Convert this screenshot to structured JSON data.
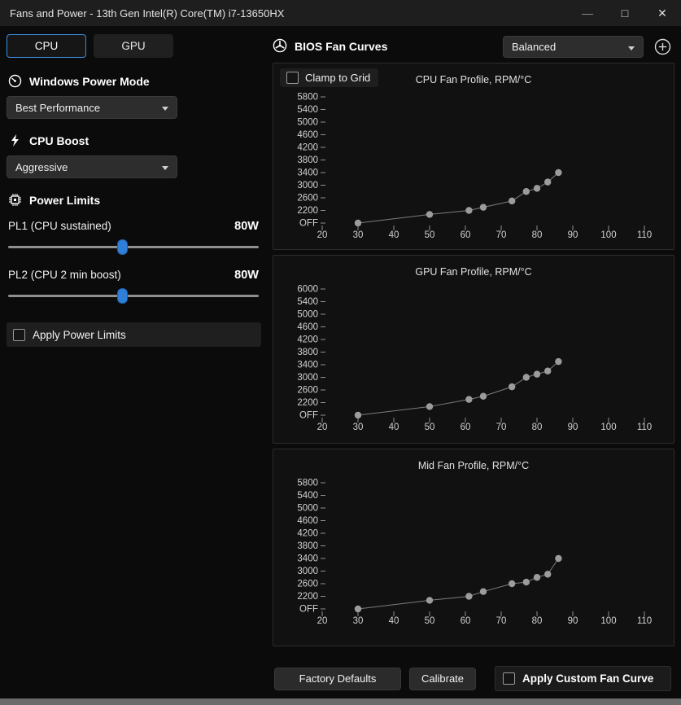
{
  "window": {
    "title": "Fans and Power - 13th Gen Intel(R) Core(TM) i7-13650HX",
    "controls": {
      "minimize": "—",
      "maximize": "□",
      "close": "✕"
    }
  },
  "tabs": {
    "cpu": "CPU",
    "gpu": "GPU"
  },
  "left": {
    "power_mode": {
      "label": "Windows Power Mode",
      "value": "Best Performance"
    },
    "cpu_boost": {
      "label": "CPU Boost",
      "value": "Aggressive"
    },
    "power_limits": {
      "label": "Power Limits",
      "pl1": {
        "label": "PL1 (CPU sustained)",
        "value": "80W",
        "percent": 45.5
      },
      "pl2": {
        "label": "PL2 (CPU 2 min boost)",
        "value": "80W",
        "percent": 45.5
      },
      "apply_label": "Apply Power Limits"
    }
  },
  "right": {
    "header": {
      "title": "BIOS Fan Curves",
      "preset": "Balanced"
    },
    "clamp_label": "Clamp to Grid",
    "footer": {
      "factory": "Factory Defaults",
      "calibrate": "Calibrate",
      "apply_custom": "Apply Custom Fan Curve"
    }
  },
  "colors": {
    "accent": "#3e8ee0",
    "chart_dot": "#9c9c9c",
    "chart_line": "#7d7d7d",
    "tick": "#8f8f8f"
  },
  "chart_data": [
    {
      "type": "scatter",
      "title": "CPU Fan Profile, RPM/°C",
      "x_ticks": [
        20,
        30,
        40,
        50,
        60,
        70,
        80,
        90,
        100,
        110
      ],
      "y_tick_labels": [
        "OFF",
        "2200",
        "2600",
        "3000",
        "3400",
        "3800",
        "4200",
        "4600",
        "5000",
        "5400",
        "5800"
      ],
      "y_tick_values": [
        0,
        2200,
        2600,
        3000,
        3400,
        3800,
        4200,
        4600,
        5000,
        5400,
        5800
      ],
      "points": [
        [
          30,
          0
        ],
        [
          50,
          1500
        ],
        [
          61,
          2200
        ],
        [
          65,
          2300
        ],
        [
          73,
          2500
        ],
        [
          77,
          2800
        ],
        [
          80,
          2900
        ],
        [
          83,
          3100
        ],
        [
          86,
          3400
        ]
      ]
    },
    {
      "type": "scatter",
      "title": "GPU Fan Profile, RPM/°C",
      "x_ticks": [
        20,
        30,
        40,
        50,
        60,
        70,
        80,
        90,
        100,
        110
      ],
      "y_tick_labels": [
        "OFF",
        "2200",
        "2600",
        "3000",
        "3400",
        "3800",
        "4200",
        "4600",
        "5000",
        "5400",
        "6000"
      ],
      "y_tick_values": [
        0,
        2200,
        2600,
        3000,
        3400,
        3800,
        4200,
        4600,
        5000,
        5400,
        6000
      ],
      "points": [
        [
          30,
          0
        ],
        [
          50,
          1500
        ],
        [
          61,
          2300
        ],
        [
          65,
          2400
        ],
        [
          73,
          2700
        ],
        [
          77,
          3000
        ],
        [
          80,
          3100
        ],
        [
          83,
          3200
        ],
        [
          86,
          3500
        ]
      ]
    },
    {
      "type": "scatter",
      "title": "Mid Fan Profile, RPM/°C",
      "x_ticks": [
        20,
        30,
        40,
        50,
        60,
        70,
        80,
        90,
        100,
        110
      ],
      "y_tick_labels": [
        "OFF",
        "2200",
        "2600",
        "3000",
        "3400",
        "3800",
        "4200",
        "4600",
        "5000",
        "5400",
        "5800"
      ],
      "y_tick_values": [
        0,
        2200,
        2600,
        3000,
        3400,
        3800,
        4200,
        4600,
        5000,
        5400,
        5800
      ],
      "points": [
        [
          30,
          0
        ],
        [
          50,
          1500
        ],
        [
          61,
          2200
        ],
        [
          65,
          2350
        ],
        [
          73,
          2600
        ],
        [
          77,
          2650
        ],
        [
          80,
          2800
        ],
        [
          83,
          2900
        ],
        [
          86,
          3400
        ]
      ]
    }
  ]
}
